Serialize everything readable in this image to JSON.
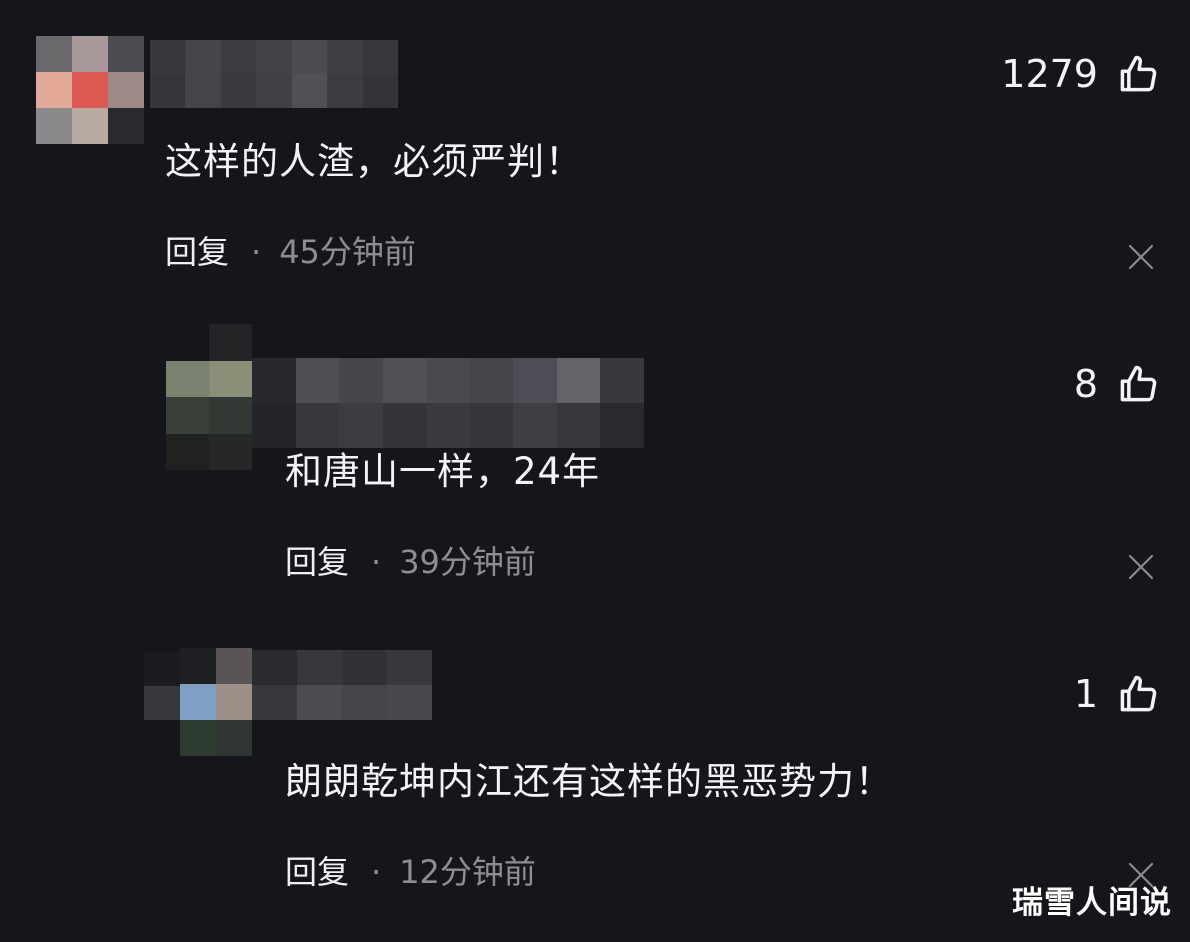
{
  "comments": [
    {
      "text": "这样的人渣，必须严判！",
      "likes": "1279",
      "reply_label": "回复",
      "separator": "·",
      "time": "45分钟前"
    },
    {
      "text": "和唐山一样，24年",
      "likes": "8",
      "reply_label": "回复",
      "separator": "·",
      "time": "39分钟前"
    },
    {
      "text": "朗朗乾坤内江还有这样的黑恶势力！",
      "likes": "1",
      "reply_label": "回复",
      "separator": "·",
      "time": "12分钟前"
    }
  ],
  "watermark": "瑞雪人间说",
  "icons": {
    "like": "thumbs-up-icon",
    "dismiss": "close-icon"
  },
  "colors": {
    "background": "#15161b",
    "text": "#f4f4f6",
    "muted": "#8d8e94",
    "icon": "#f4f4f6",
    "close": "#8a8b90"
  }
}
